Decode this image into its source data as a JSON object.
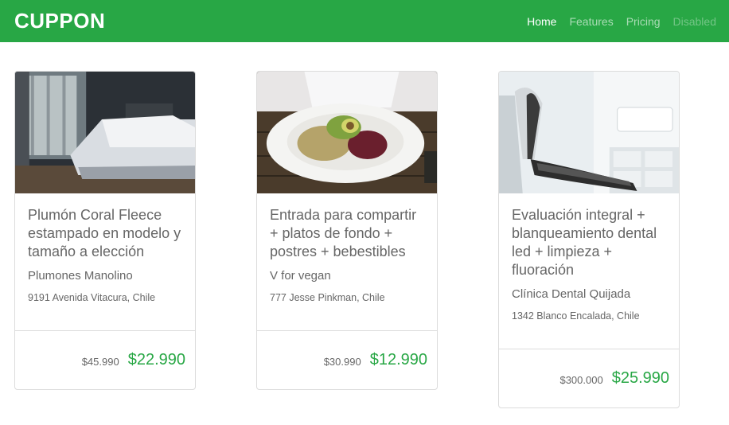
{
  "navbar": {
    "brand": "CUPPON",
    "links": [
      {
        "label": "Home",
        "state": "active"
      },
      {
        "label": "Features",
        "state": "normal"
      },
      {
        "label": "Pricing",
        "state": "normal"
      },
      {
        "label": "Disabled",
        "state": "disabled"
      }
    ]
  },
  "colors": {
    "accent": "#28a745",
    "text": "#666666",
    "border": "#dcdcdc"
  },
  "cards": [
    {
      "image": "bedroom-photo",
      "title": "Plumón Coral Fleece estampado en modelo y tamaño a elección",
      "merchant": "Plumones Manolino",
      "address": "9191 Avenida Vitacura, Chile",
      "old_price": "$45.990",
      "new_price": "$22.990"
    },
    {
      "image": "salad-bowl-photo",
      "title": "Entrada para compartir + platos de fondo + postres + bebestibles",
      "merchant": "V for vegan",
      "address": "777 Jesse Pinkman, Chile",
      "old_price": "$30.990",
      "new_price": "$12.990"
    },
    {
      "image": "dental-chair-photo",
      "title": "Evaluación integral + blanqueamiento dental led + limpieza + fluoración",
      "merchant": "Clínica Dental Quijada",
      "address": "1342 Blanco Encalada, Chile",
      "old_price": "$300.000",
      "new_price": "$25.990"
    }
  ]
}
